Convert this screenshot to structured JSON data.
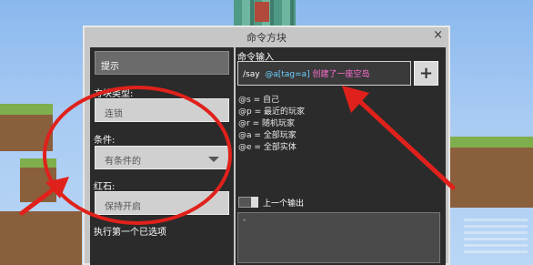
{
  "window": {
    "title": "命令方块",
    "close_label": "×"
  },
  "left_panel": {
    "hint_label": "提示",
    "block_type": {
      "label": "方块类型:",
      "value": "连锁"
    },
    "condition": {
      "label": "条件:",
      "value": "有条件的"
    },
    "redstone": {
      "label": "红石:",
      "value": "保持开启"
    },
    "execute_first_label": "执行第一个已选项"
  },
  "right_panel": {
    "command_label": "命令输入",
    "command": {
      "cmd": "/say",
      "selector": "@a[tag=a]",
      "message": "创建了一座空岛"
    },
    "add_button_label": "+",
    "help_rows": [
      {
        "key": "@s",
        "desc": "= 自己"
      },
      {
        "key": "@p",
        "desc": "= 最近的玩家"
      },
      {
        "key": "@r",
        "desc": "= 随机玩家"
      },
      {
        "key": "@a",
        "desc": "= 全部玩家"
      },
      {
        "key": "@e",
        "desc": "= 全部实体"
      }
    ],
    "previous_output_label": "上一个输出",
    "output_text": "-"
  },
  "colors": {
    "annotation_red": "#e0211b",
    "selector": "#6bd0ff",
    "message": "#ff6fd3"
  }
}
